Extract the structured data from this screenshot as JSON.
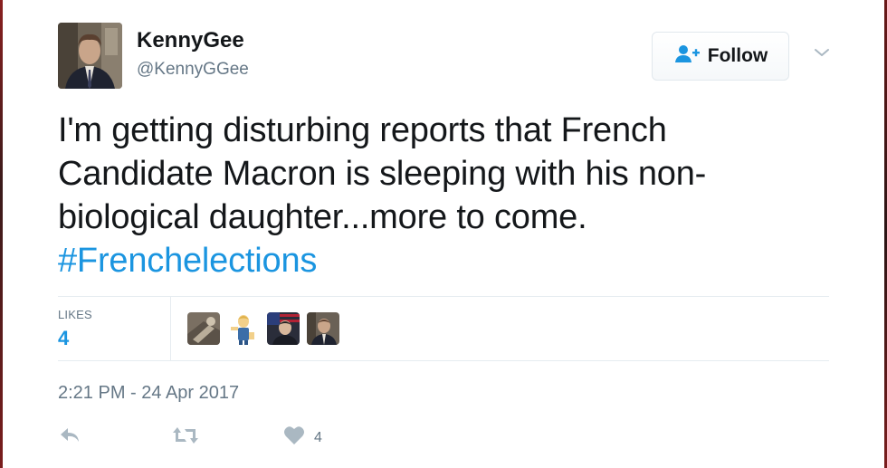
{
  "tweet": {
    "display_name": "KennyGee",
    "screen_name": "@KennyGGee",
    "text_lines": [
      "I'm getting disturbing reports that French",
      "Candidate Macron is sleeping with his non-",
      "biological daughter...more to come."
    ],
    "hashtag": "#Frenchelections",
    "timestamp": "2:21 PM - 24 Apr 2017"
  },
  "follow_button": {
    "label": "Follow",
    "icon": "follow-user-icon"
  },
  "menu": {
    "icon": "chevron-down-icon"
  },
  "stats": {
    "likes_label": "LIKES",
    "likes_count": "4",
    "liker_avatars": [
      "liker-avatar-1",
      "liker-avatar-2",
      "liker-avatar-3",
      "liker-avatar-4"
    ]
  },
  "actions": {
    "reply_icon": "reply-icon",
    "retweet_icon": "retweet-icon",
    "like_icon": "heart-icon",
    "like_count": "4"
  },
  "colors": {
    "link": "#1b95e0",
    "text": "#14171a",
    "secondary": "#657786",
    "action_icon": "#aab8c2"
  }
}
